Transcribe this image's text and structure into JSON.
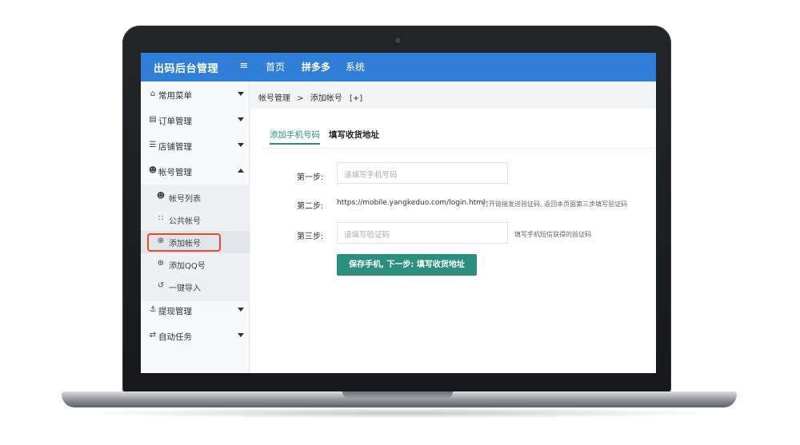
{
  "header": {
    "brand": "出码后台管理",
    "menu_toggle_icon": "menu-fold-icon",
    "nav": [
      "首页",
      "拼多多",
      "系统"
    ]
  },
  "sidebar": {
    "items": [
      {
        "label": "常用菜单",
        "icon": "home-icon"
      },
      {
        "label": "订单管理",
        "icon": "order-icon"
      },
      {
        "label": "店铺管理",
        "icon": "list-icon"
      },
      {
        "label": "帐号管理",
        "icon": "user-icon"
      },
      {
        "label": "提现管理",
        "icon": "anchor-icon"
      },
      {
        "label": "自动任务",
        "icon": "sync-icon"
      }
    ],
    "sub_items": [
      {
        "label": "帐号列表",
        "icon": "user-icon"
      },
      {
        "label": "公共帐号",
        "icon": "group-icon"
      },
      {
        "label": "添加帐号",
        "icon": "plus-circle-icon"
      },
      {
        "label": "添加QQ号",
        "icon": "plus-circle-icon"
      },
      {
        "label": "一键导入",
        "icon": "import-icon"
      }
    ]
  },
  "breadcrumb": {
    "parent": "帐号管理",
    "separator": ">",
    "current": "添加帐号",
    "extra": "[+]"
  },
  "tabs": [
    "添加手机号码",
    "填写收货地址"
  ],
  "form": {
    "step1_label": "第一步:",
    "step1_placeholder": "请填写手机号码",
    "step2_label": "第二步:",
    "step2_url": "https://mobile.yangkeduo.com/login.html",
    "step2_hint": "打开链接发送验证码, 返回本页面第三步填写验证码",
    "step3_label": "第三步:",
    "step3_placeholder": "请填写验证码",
    "step3_hint": "填写手机短信获得的验证码",
    "submit_label": "保存手机, 下一步: 填写收货地址"
  },
  "colors": {
    "header": "#2f7fd8",
    "accent": "#2b8f7d",
    "highlight_box": "#e34b2f"
  }
}
